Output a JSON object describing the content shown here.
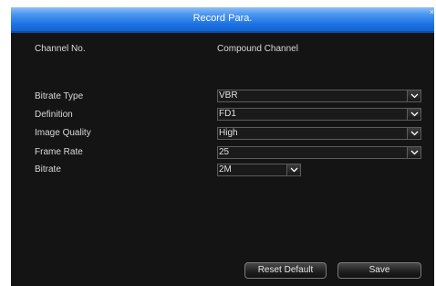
{
  "window": {
    "title": "Record Para.",
    "close_glyph": "×"
  },
  "fields": {
    "channel_no_label": "Channel No.",
    "channel_no_value": "Compound Channel",
    "bitrate_type_label": "Bitrate Type",
    "bitrate_type_value": "VBR",
    "definition_label": "Definition",
    "definition_value": "FD1",
    "image_quality_label": "Image Quality",
    "image_quality_value": "High",
    "frame_rate_label": "Frame Rate",
    "frame_rate_value": "25",
    "bitrate_label": "Bitrate",
    "bitrate_value": "2M"
  },
  "buttons": {
    "reset_default_label": "Reset Default",
    "save_label": "Save"
  },
  "icons": {
    "dropdown": "chevron-down-icon",
    "close": "close-icon"
  },
  "colors": {
    "titlebar_accent": "#1d73e6",
    "background": "#141414"
  }
}
